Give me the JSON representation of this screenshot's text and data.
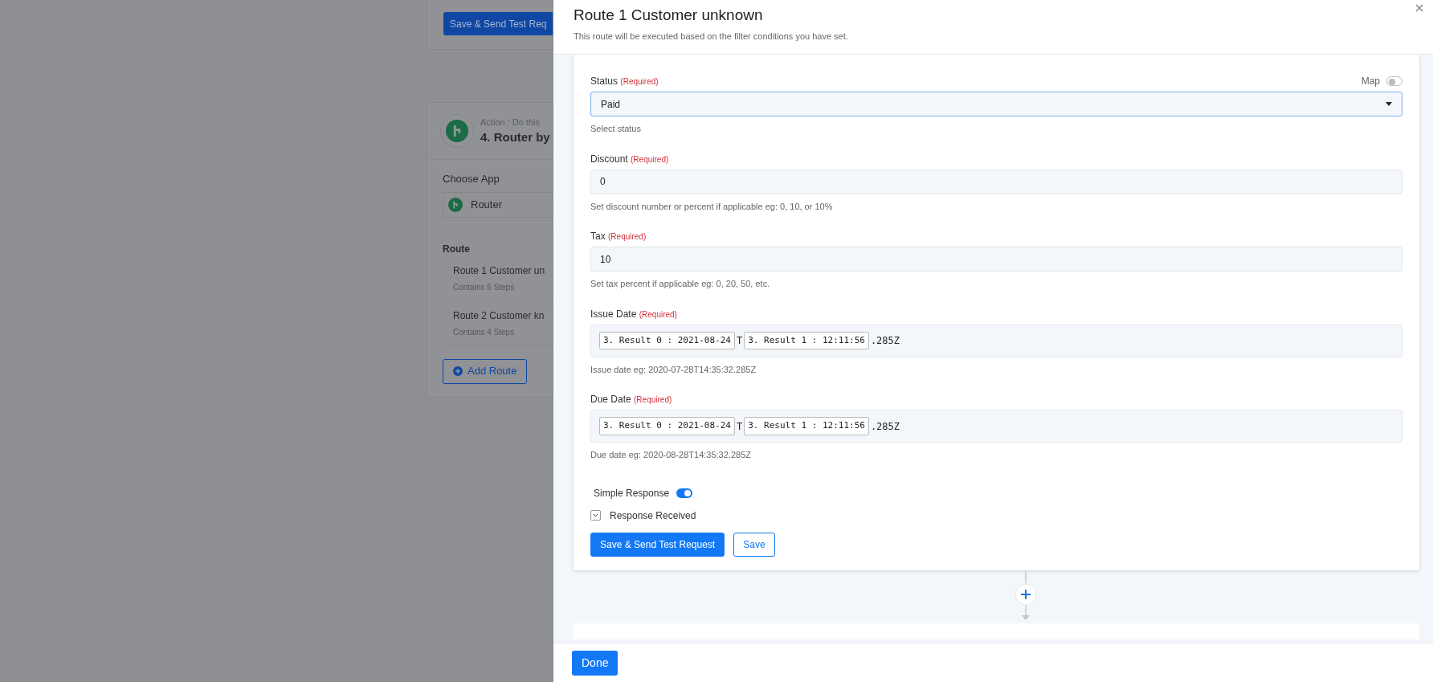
{
  "background": {
    "top_card": {
      "button": "Save & Send Test Req"
    },
    "step_card": {
      "action_label": "Action : Do this",
      "title": "4. Router by",
      "choose_app_label": "Choose App",
      "app_value": "Router",
      "route_heading": "Route",
      "routes": [
        {
          "name": "Route 1 Customer un",
          "steps": "Contains 6 Steps"
        },
        {
          "name": "Route 2 Customer kn",
          "steps": "Contains 4 Steps"
        }
      ],
      "add_route_button": "Add Route"
    }
  },
  "modal": {
    "title": "Route 1 Customer unknown",
    "subtitle": "This route will be executed based on the filter conditions you have set.",
    "fields": [
      {
        "kind": "select",
        "label": "Status",
        "required": "(Required)",
        "map_toggle": {
          "label": "Map",
          "on": false
        },
        "value": "Paid",
        "hint": "Select status"
      },
      {
        "kind": "text",
        "label": "Discount",
        "required": "(Required)",
        "value": "0",
        "hint": "Set discount number or percent if applicable eg: 0, 10, or 10%"
      },
      {
        "kind": "text",
        "label": "Tax",
        "required": "(Required)",
        "value": "10",
        "hint": "Set tax percent if applicable eg: 0, 20, 50, etc."
      },
      {
        "kind": "datetime",
        "label": "Issue Date",
        "required": "(Required)",
        "segments": [
          {
            "kind": "token",
            "text": "3. Result 0 : 2021-08-24"
          },
          {
            "kind": "text",
            "text": "T"
          },
          {
            "kind": "token",
            "text": "3. Result 1 : 12:11:56"
          },
          {
            "kind": "text",
            "text": ".285Z"
          }
        ],
        "hint": "Issue date eg: 2020-07-28T14:35:32.285Z"
      },
      {
        "kind": "datetime",
        "label": "Due Date",
        "required": "(Required)",
        "segments": [
          {
            "kind": "token",
            "text": "3. Result 0 : 2021-08-24"
          },
          {
            "kind": "text",
            "text": "T"
          },
          {
            "kind": "token",
            "text": "3. Result 1 : 12:11:56"
          },
          {
            "kind": "text",
            "text": ".285Z"
          }
        ],
        "hint": "Due date eg: 2020-08-28T14:35:32.285Z"
      }
    ],
    "simple_response": {
      "label": "Simple Response",
      "on": true
    },
    "response_received": {
      "label": "Response Received",
      "expanded": false
    },
    "buttons": [
      {
        "kind": "primary",
        "label": "Save & Send Test Request"
      },
      {
        "kind": "outline",
        "label": "Save"
      }
    ],
    "done_button": "Done"
  }
}
